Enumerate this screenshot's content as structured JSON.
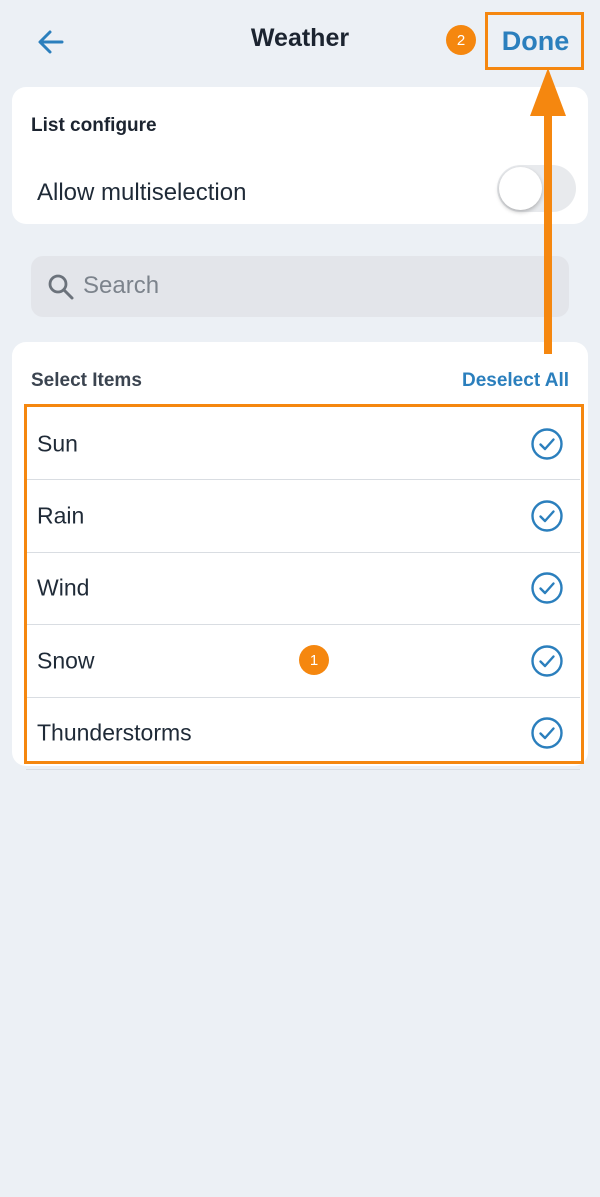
{
  "header": {
    "title": "Weather",
    "done_label": "Done"
  },
  "config": {
    "section_title": "List configure",
    "multiselect_label": "Allow multiselection",
    "multiselect_enabled": false
  },
  "search": {
    "placeholder": "Search",
    "value": ""
  },
  "list": {
    "section_title": "Select Items",
    "deselect_label": "Deselect All",
    "items": [
      {
        "label": "Sun",
        "selected": true
      },
      {
        "label": "Rain",
        "selected": true
      },
      {
        "label": "Wind",
        "selected": true
      },
      {
        "label": "Snow",
        "selected": true
      },
      {
        "label": "Thunderstorms",
        "selected": true
      }
    ]
  },
  "annotations": {
    "badge_1": "1",
    "badge_2": "2",
    "color": "#f5870f"
  },
  "colors": {
    "accent": "#2b7fbd",
    "background": "#ecf0f5"
  },
  "icons": {
    "back": "arrow-left-icon",
    "search": "search-icon",
    "check": "check-circle-icon"
  }
}
